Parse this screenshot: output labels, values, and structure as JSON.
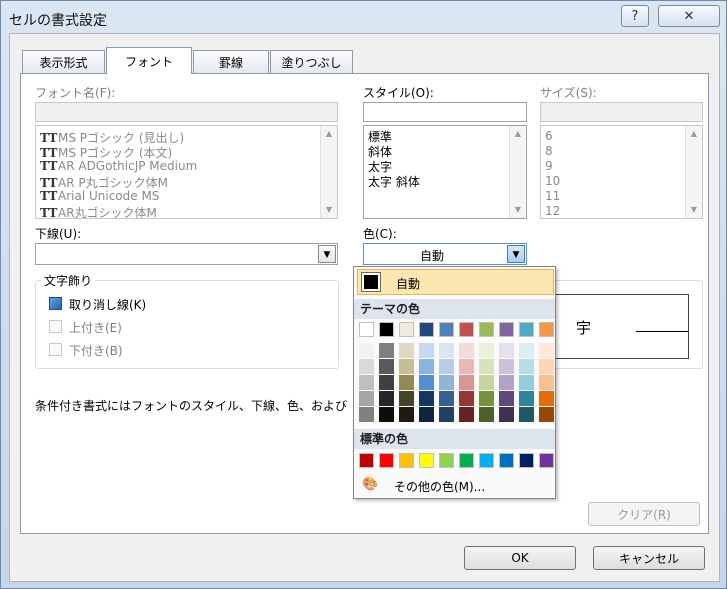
{
  "window": {
    "title": "セルの書式設定",
    "help_button": "?",
    "close_button": "✕"
  },
  "tabs": [
    {
      "label": "表示形式"
    },
    {
      "label": "フォント"
    },
    {
      "label": "罫線"
    },
    {
      "label": "塗りつぶし"
    }
  ],
  "font": {
    "name_label": "フォント名(F):",
    "name_value": "",
    "name_list": [
      "MS Pゴシック (見出し)",
      "MS Pゴシック (本文)",
      "AR ADGothicJP Medium",
      "AR P丸ゴシック体M",
      "Arial Unicode MS",
      "AR丸ゴシック体M"
    ],
    "style_label": "スタイル(O):",
    "style_value": "",
    "style_list": [
      "標準",
      "斜体",
      "太字",
      "太字 斜体"
    ],
    "size_label": "サイズ(S):",
    "size_value": "",
    "size_list": [
      "6",
      "8",
      "9",
      "10",
      "11",
      "12"
    ],
    "underline_label": "下線(U):",
    "underline_value": "",
    "color_label": "色(C):",
    "color_value": "自動"
  },
  "effects": {
    "group_title": "文字飾り",
    "strikethrough": "取り消し線(K)",
    "superscript": "上付き(E)",
    "subscript": "下付き(B)"
  },
  "preview": {
    "sample_text": "宇"
  },
  "note": "条件付き書式にはフォントのスタイル、下線、色、および",
  "clear_button": "クリア(R)",
  "ok_button": "OK",
  "cancel_button": "キャンセル",
  "color_popup": {
    "auto_label": "自動",
    "theme_header": "テーマの色",
    "standard_header": "標準の色",
    "more_colors": "その他の色(M)...",
    "theme_top": [
      "#ffffff",
      "#000000",
      "#eeece1",
      "#1f497d",
      "#4f81bd",
      "#c0504d",
      "#9bbb59",
      "#8064a2",
      "#4bacc6",
      "#f79646"
    ],
    "theme_shades": [
      [
        "#f2f2f2",
        "#d9d9d9",
        "#bfbfbf",
        "#a6a6a6",
        "#808080"
      ],
      [
        "#7f7f7f",
        "#595959",
        "#404040",
        "#262626",
        "#0d0d0d"
      ],
      [
        "#ddd9c3",
        "#c4bd97",
        "#938953",
        "#494429",
        "#1d1b10"
      ],
      [
        "#c6d9f0",
        "#8db3e2",
        "#548dd4",
        "#17365d",
        "#0f243e"
      ],
      [
        "#dbe5f1",
        "#b8cce4",
        "#95b3d7",
        "#366092",
        "#244061"
      ],
      [
        "#f2dcdb",
        "#e5b9b7",
        "#d99694",
        "#953734",
        "#632423"
      ],
      [
        "#ebf1dd",
        "#d7e3bc",
        "#c3d69b",
        "#76923c",
        "#4f6128"
      ],
      [
        "#e5e0ec",
        "#ccc1d9",
        "#b2a2c7",
        "#5f497a",
        "#3f3151"
      ],
      [
        "#dbeef3",
        "#b7dde8",
        "#92cddc",
        "#31859b",
        "#205867"
      ],
      [
        "#fdeada",
        "#fbd5b5",
        "#fac08f",
        "#e36c09",
        "#974806"
      ]
    ],
    "standard": [
      "#c00000",
      "#ff0000",
      "#ffc000",
      "#ffff00",
      "#92d050",
      "#00b050",
      "#00b0f0",
      "#0070c0",
      "#002060",
      "#7030a0"
    ]
  }
}
